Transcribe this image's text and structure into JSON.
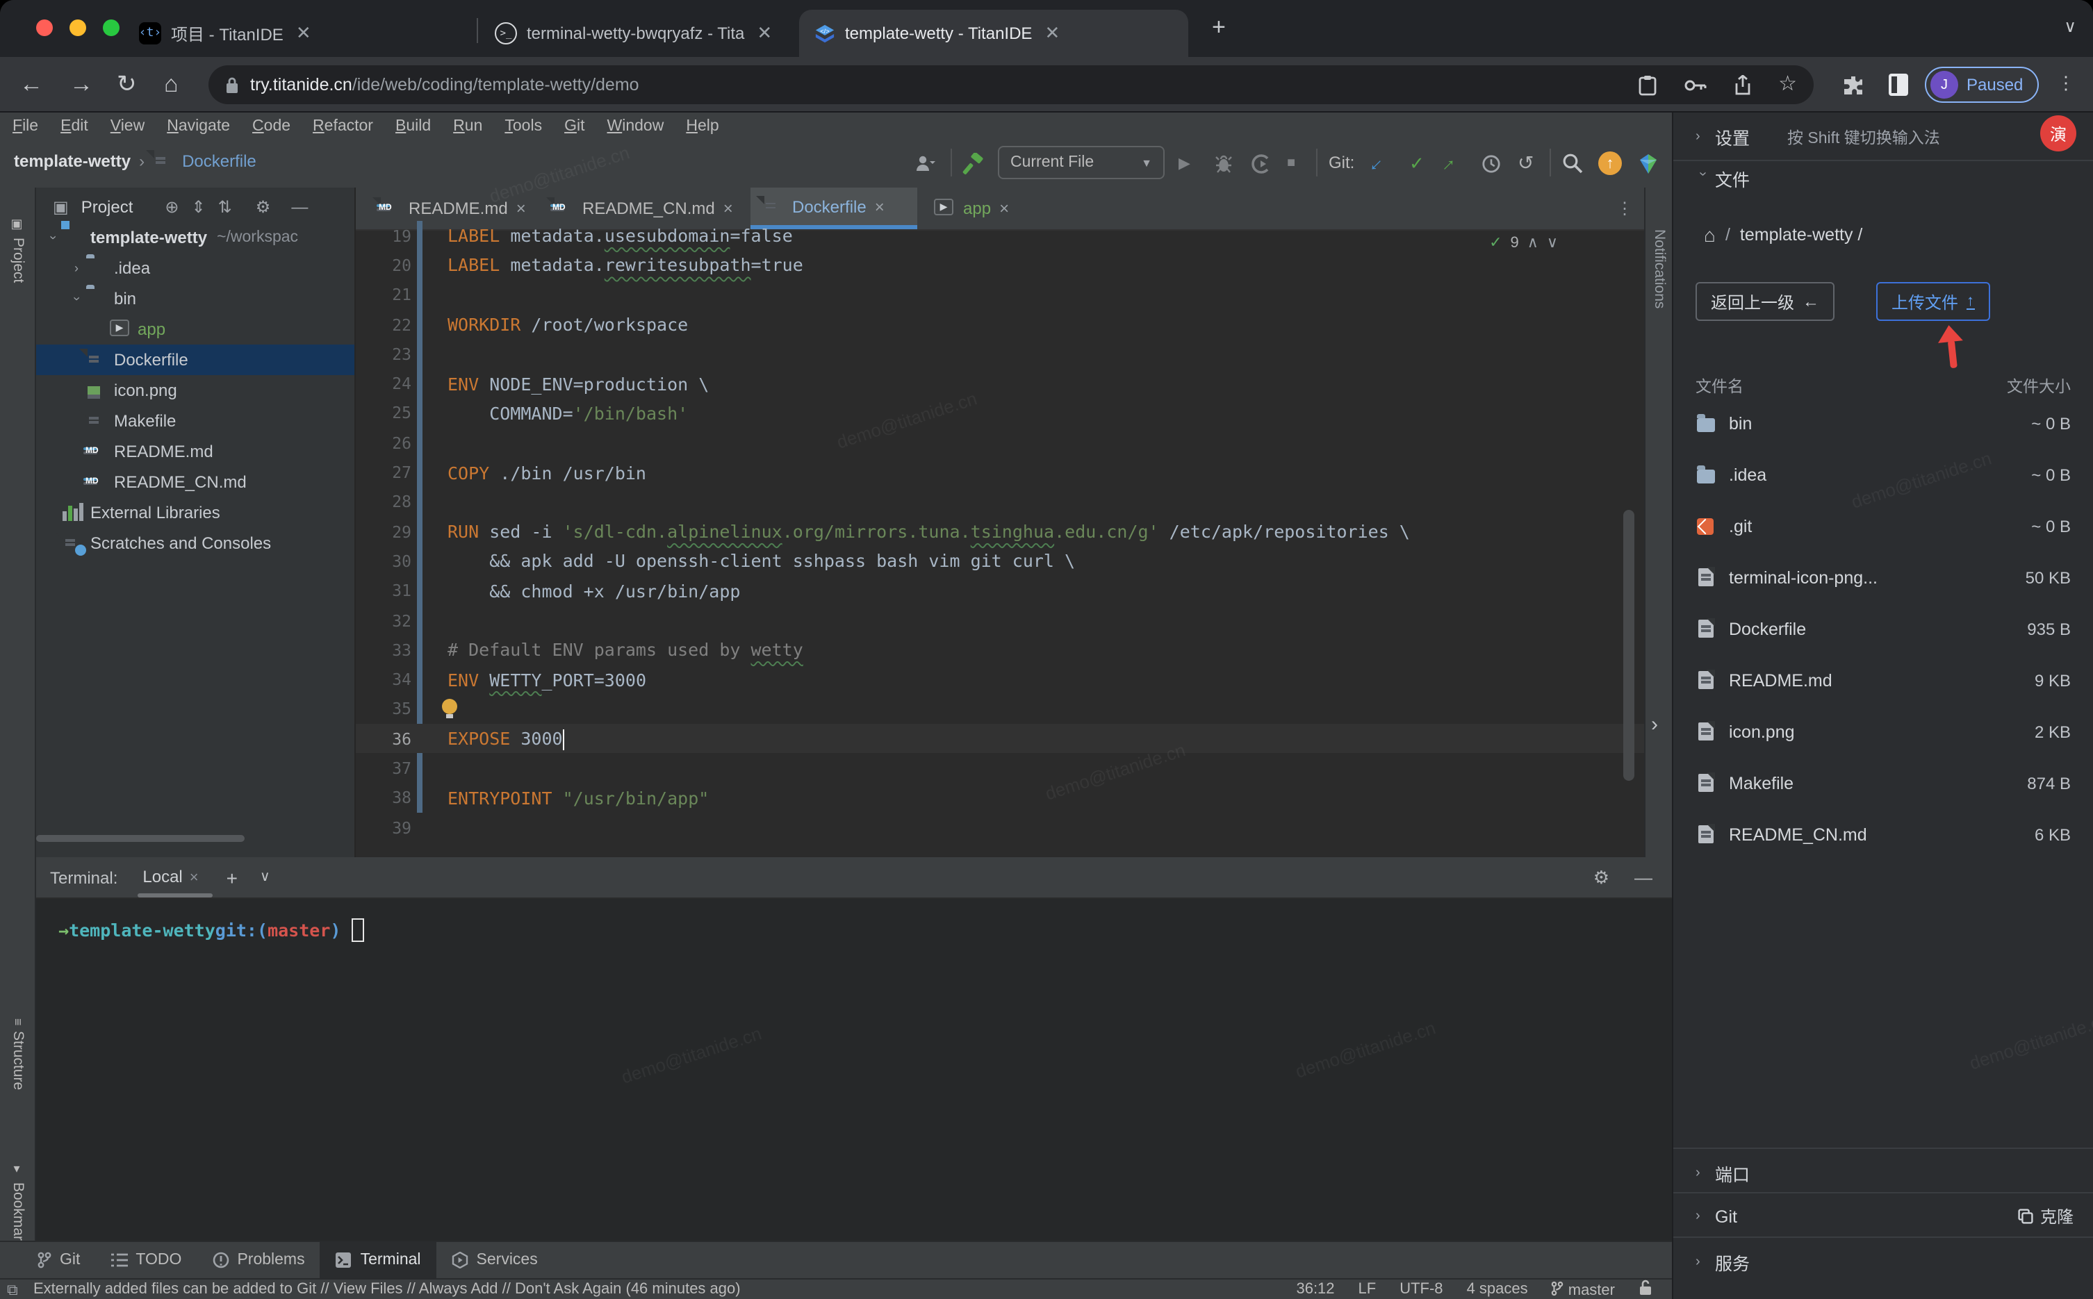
{
  "browser": {
    "tabs": [
      {
        "title": "项目 - TitanIDE",
        "icon": "titan-t-icon",
        "active": false
      },
      {
        "title": "terminal-wetty-bwqryafz - Tita",
        "icon": "terminal-circle-icon",
        "active": false
      },
      {
        "title": "template-wetty - TitanIDE",
        "icon": "titan-logo-icon",
        "active": true
      }
    ],
    "url_host": "try.titanide.cn",
    "url_path": "/ide/web/coding/template-wetty/demo",
    "profile": {
      "initial": "J",
      "label": "Paused"
    }
  },
  "menubar": {
    "items": [
      "File",
      "Edit",
      "View",
      "Navigate",
      "Code",
      "Refactor",
      "Build",
      "Run",
      "Tools",
      "Git",
      "Window",
      "Help"
    ]
  },
  "breadcrumb": {
    "project": "template-wetty",
    "file": "Dockerfile"
  },
  "ide_toolbar": {
    "run_config": "Current File",
    "git_label": "Git:"
  },
  "left_stripe": {
    "project": "Project",
    "structure": "Structure",
    "bookmarks": "Bookmarks"
  },
  "project_panel": {
    "title": "Project",
    "tree": [
      {
        "label": "template-wetty",
        "meta": "~/workspac",
        "icon": "folder-root",
        "depth": 0,
        "chevron": "open",
        "bold": true
      },
      {
        "label": ".idea",
        "icon": "folder",
        "depth": 1,
        "chevron": "closed"
      },
      {
        "label": "bin",
        "icon": "folder",
        "depth": 1,
        "chevron": "open"
      },
      {
        "label": "app",
        "icon": "app",
        "depth": 2,
        "color": "green"
      },
      {
        "label": "Dockerfile",
        "icon": "file",
        "depth": 1,
        "selected": true
      },
      {
        "label": "icon.png",
        "icon": "image",
        "depth": 1
      },
      {
        "label": "Makefile",
        "icon": "file",
        "depth": 1
      },
      {
        "label": "README.md",
        "icon": "md",
        "depth": 1
      },
      {
        "label": "README_CN.md",
        "icon": "md",
        "depth": 1
      },
      {
        "label": "External Libraries",
        "icon": "lib",
        "depth": 0
      },
      {
        "label": "Scratches and Consoles",
        "icon": "scratch",
        "depth": 0
      }
    ]
  },
  "editor": {
    "tabs": [
      {
        "label": "README.md",
        "icon": "md",
        "active": false
      },
      {
        "label": "README_CN.md",
        "icon": "md",
        "active": false
      },
      {
        "label": "Dockerfile",
        "icon": "file",
        "active": true
      },
      {
        "label": "app",
        "icon": "app",
        "active": false,
        "color": "green"
      }
    ],
    "inspections_count": "9",
    "notifications_label": "Notifications",
    "current_line": 36,
    "lines": [
      {
        "n": 19,
        "segs": [
          [
            "sk",
            "LABEL"
          ],
          [
            "sp",
            " metadata."
          ],
          [
            "spw",
            "usesubdomain"
          ],
          [
            "sp",
            "=false"
          ]
        ]
      },
      {
        "n": 20,
        "segs": [
          [
            "sk",
            "LABEL"
          ],
          [
            "sp",
            " metadata."
          ],
          [
            "spw",
            "rewritesubpath"
          ],
          [
            "sp",
            "=true"
          ]
        ]
      },
      {
        "n": 21,
        "segs": []
      },
      {
        "n": 22,
        "segs": [
          [
            "sk",
            "WORKDIR"
          ],
          [
            "sp",
            " /root/workspace"
          ]
        ]
      },
      {
        "n": 23,
        "segs": []
      },
      {
        "n": 24,
        "segs": [
          [
            "sk",
            "ENV"
          ],
          [
            "sp",
            " NODE_ENV=production \\"
          ]
        ]
      },
      {
        "n": 25,
        "segs": [
          [
            "sp",
            "    COMMAND="
          ],
          [
            "ss",
            "'/bin/bash'"
          ]
        ]
      },
      {
        "n": 26,
        "segs": []
      },
      {
        "n": 27,
        "segs": [
          [
            "sk",
            "COPY"
          ],
          [
            "sp",
            " ./bin /usr/bin"
          ]
        ]
      },
      {
        "n": 28,
        "segs": []
      },
      {
        "n": 29,
        "segs": [
          [
            "sk",
            "RUN"
          ],
          [
            "sp",
            " sed -i "
          ],
          [
            "ss",
            "'s/dl-cdn."
          ],
          [
            "ssw",
            "alpinelinux"
          ],
          [
            "ss",
            ".org/mirrors.tuna."
          ],
          [
            "ssw",
            "tsinghua"
          ],
          [
            "ss",
            ".edu.cn/g'"
          ],
          [
            "sp",
            " /etc/apk/repositories \\"
          ]
        ]
      },
      {
        "n": 30,
        "segs": [
          [
            "sp",
            "    && apk add -U openssh-client sshpass bash vim git curl \\"
          ]
        ]
      },
      {
        "n": 31,
        "segs": [
          [
            "sp",
            "    && chmod +x /usr/bin/app"
          ]
        ]
      },
      {
        "n": 32,
        "segs": []
      },
      {
        "n": 33,
        "segs": [
          [
            "sc",
            "# Default ENV params used by "
          ],
          [
            "scw",
            "wetty"
          ]
        ]
      },
      {
        "n": 34,
        "segs": [
          [
            "sk",
            "ENV"
          ],
          [
            "sp",
            " "
          ],
          [
            "spw",
            "WETTY"
          ],
          [
            "sp",
            "_PORT=3000"
          ]
        ]
      },
      {
        "n": 35,
        "segs": [],
        "bulb": true
      },
      {
        "n": 36,
        "segs": [
          [
            "sk",
            "EXPOSE"
          ],
          [
            "sp",
            " 3000"
          ]
        ],
        "caret": true
      },
      {
        "n": 37,
        "segs": []
      },
      {
        "n": 38,
        "segs": [
          [
            "sk",
            "ENTRYPOINT"
          ],
          [
            "sp",
            " "
          ],
          [
            "ss",
            "\"/usr/bin/app\""
          ]
        ]
      },
      {
        "n": 39,
        "segs": []
      }
    ]
  },
  "terminal": {
    "title": "Terminal:",
    "tab": "Local",
    "prompt": [
      [
        "pa",
        "→"
      ],
      [
        "pd",
        " template-wetty "
      ],
      [
        "pg",
        "git:("
      ],
      [
        "pm",
        "master"
      ],
      [
        "pg",
        ")"
      ]
    ]
  },
  "bottom_bar": {
    "buttons": [
      {
        "label": "Git",
        "icon": "git-branch-icon",
        "active": false
      },
      {
        "label": "TODO",
        "icon": "todo-list-icon",
        "active": false
      },
      {
        "label": "Problems",
        "icon": "problems-icon",
        "active": false
      },
      {
        "label": "Terminal",
        "icon": "terminal-icon",
        "active": true
      },
      {
        "label": "Services",
        "icon": "services-icon",
        "active": false
      }
    ],
    "status_left": "Externally added files can be added to Git // View Files // Always Add // Don't Ask Again (46 minutes ago)",
    "status_items": [
      "36:12",
      "LF",
      "UTF-8",
      "4 spaces"
    ],
    "branch": "master"
  },
  "right_panel": {
    "settings_label": "设置",
    "ime_hint": "按 Shift 键切换输入法",
    "demo_badge": "演",
    "files_section_label": "文件",
    "path": "template-wetty /",
    "back_button": "返回上一级",
    "upload_button": "上传文件",
    "table": {
      "name_header": "文件名",
      "size_header": "文件大小",
      "rows": [
        {
          "name": "bin",
          "size": "~ 0 B",
          "icon": "folder"
        },
        {
          "name": ".idea",
          "size": "~ 0 B",
          "icon": "folder"
        },
        {
          "name": ".git",
          "size": "~ 0 B",
          "icon": "git"
        },
        {
          "name": "terminal-icon-png...",
          "size": "50 KB",
          "icon": "file"
        },
        {
          "name": "Dockerfile",
          "size": "935 B",
          "icon": "file"
        },
        {
          "name": "README.md",
          "size": "9 KB",
          "icon": "file"
        },
        {
          "name": "icon.png",
          "size": "2 KB",
          "icon": "file"
        },
        {
          "name": "Makefile",
          "size": "874 B",
          "icon": "file"
        },
        {
          "name": "README_CN.md",
          "size": "6 KB",
          "icon": "file"
        }
      ]
    },
    "bottom_sections": [
      {
        "label": "端口"
      },
      {
        "label": "Git",
        "action": "克隆"
      },
      {
        "label": "服务"
      }
    ]
  },
  "watermark": "demo@titanide.cn"
}
